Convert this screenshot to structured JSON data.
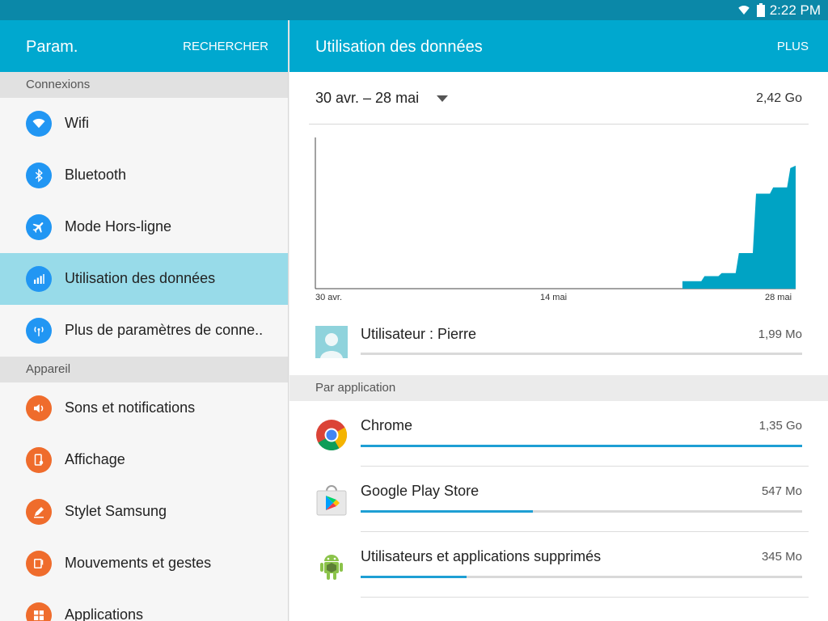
{
  "status": {
    "time": "2:22 PM"
  },
  "left": {
    "title": "Param.",
    "search": "RECHERCHER",
    "sections": [
      {
        "title": "Connexions",
        "items": [
          {
            "label": "Wifi",
            "icon": "wifi-icon"
          },
          {
            "label": "Bluetooth",
            "icon": "bluetooth-icon"
          },
          {
            "label": "Mode Hors-ligne",
            "icon": "airplane-icon"
          },
          {
            "label": "Utilisation des données",
            "icon": "data-usage-icon",
            "active": true
          },
          {
            "label": "Plus de paramètres de conne..",
            "icon": "antenna-icon"
          }
        ]
      },
      {
        "title": "Appareil",
        "items": [
          {
            "label": "Sons et notifications",
            "icon": "speaker-icon"
          },
          {
            "label": "Affichage",
            "icon": "display-icon"
          },
          {
            "label": "Stylet Samsung",
            "icon": "pen-icon"
          },
          {
            "label": "Mouvements et gestes",
            "icon": "gesture-icon"
          },
          {
            "label": "Applications",
            "icon": "apps-icon"
          }
        ]
      }
    ]
  },
  "right": {
    "title": "Utilisation des données",
    "more": "PLUS",
    "period": "30 avr. – 28 mai",
    "total": "2,42 Go",
    "user": {
      "name": "Utilisateur : Pierre",
      "value": "1,99 Mo",
      "fraction": 0.0
    },
    "by_app_title": "Par application",
    "apps": [
      {
        "name": "Chrome",
        "value": "1,35 Go",
        "fraction": 1.0,
        "icon": "chrome-icon"
      },
      {
        "name": "Google Play Store",
        "value": "547 Mo",
        "fraction": 0.39,
        "icon": "play-store-icon"
      },
      {
        "name": "Utilisateurs et applications supprimés",
        "value": "345 Mo",
        "fraction": 0.24,
        "icon": "android-icon"
      }
    ]
  },
  "chart_data": {
    "type": "area",
    "x_tick_labels": [
      "30 avr.",
      "14 mai",
      "28 mai"
    ],
    "x": [
      "30 avr.",
      "1 mai",
      "2 mai",
      "3 mai",
      "4 mai",
      "5 mai",
      "6 mai",
      "7 mai",
      "8 mai",
      "9 mai",
      "10 mai",
      "11 mai",
      "12 mai",
      "13 mai",
      "14 mai",
      "15 mai",
      "16 mai",
      "17 mai",
      "18 mai",
      "19 mai",
      "20 mai",
      "21 mai",
      "22 mai",
      "23 mai",
      "24 mai",
      "25 mai",
      "26 mai",
      "27 mai",
      "28 mai"
    ],
    "values": [
      0,
      0,
      0,
      0,
      0,
      0,
      0,
      0,
      0,
      0,
      0,
      0,
      0,
      0,
      0,
      0,
      0,
      0,
      0,
      0,
      0,
      0,
      0.12,
      0.2,
      0.25,
      0.57,
      1.52,
      1.62,
      1.93
    ],
    "ylim": [
      0,
      2.42
    ],
    "color": "#00a3c4"
  }
}
